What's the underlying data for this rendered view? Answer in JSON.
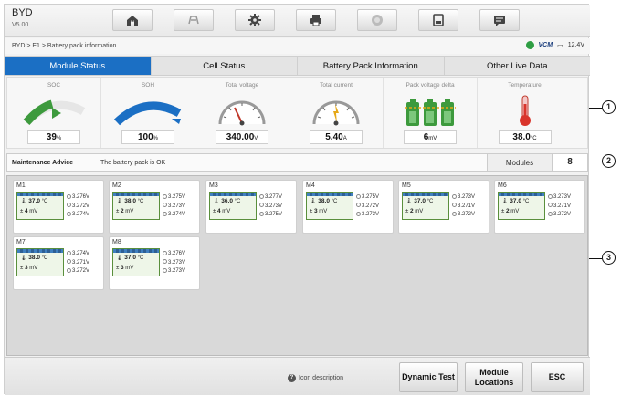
{
  "app": {
    "brand": "BYD",
    "version": "V5.00"
  },
  "toolbar": {
    "icons": [
      "home-icon",
      "vehicle-icon",
      "settings-icon",
      "print-icon",
      "help-icon",
      "save-icon",
      "message-icon"
    ]
  },
  "breadcrumb": "BYD > E1 > Battery pack information",
  "status": {
    "vcm_label": "VCM",
    "battery": "12.4V",
    "colors": {
      "connected": "#2f9e44",
      "vcm": "#1a3d7c"
    }
  },
  "tabs": [
    {
      "label": "Module Status",
      "active": true
    },
    {
      "label": "Cell Status",
      "active": false
    },
    {
      "label": "Battery Pack Information",
      "active": false
    },
    {
      "label": "Other Live Data",
      "active": false
    }
  ],
  "gauges": [
    {
      "label": "SOC",
      "value": "39",
      "unit": "%"
    },
    {
      "label": "SOH",
      "value": "100",
      "unit": "%"
    },
    {
      "label": "Total voltage",
      "value": "340.00",
      "unit": "V"
    },
    {
      "label": "Total current",
      "value": "5.40",
      "unit": "A"
    },
    {
      "label": "Pack voltage delta",
      "value": "6",
      "unit": "mV"
    },
    {
      "label": "Temperature",
      "value": "38.0",
      "unit": "°C"
    }
  ],
  "maintenance": {
    "label": "Maintenance Advice",
    "text": "The battery pack is OK",
    "modules_label": "Modules",
    "modules_count": "8"
  },
  "modules": [
    {
      "name": "M1",
      "temp": "37.0",
      "temp_unit": "°C",
      "delta": "4",
      "delta_unit": "mV",
      "volts": [
        "3.276V",
        "3.272V",
        "3.274V"
      ]
    },
    {
      "name": "M2",
      "temp": "38.0",
      "temp_unit": "°C",
      "delta": "2",
      "delta_unit": "mV",
      "volts": [
        "3.275V",
        "3.273V",
        "3.274V"
      ]
    },
    {
      "name": "M3",
      "temp": "36.0",
      "temp_unit": "°C",
      "delta": "4",
      "delta_unit": "mV",
      "volts": [
        "3.277V",
        "3.273V",
        "3.275V"
      ]
    },
    {
      "name": "M4",
      "temp": "38.0",
      "temp_unit": "°C",
      "delta": "3",
      "delta_unit": "mV",
      "volts": [
        "3.275V",
        "3.272V",
        "3.273V"
      ]
    },
    {
      "name": "M5",
      "temp": "37.0",
      "temp_unit": "°C",
      "delta": "2",
      "delta_unit": "mV",
      "volts": [
        "3.273V",
        "3.271V",
        "3.272V"
      ]
    },
    {
      "name": "M6",
      "temp": "37.0",
      "temp_unit": "°C",
      "delta": "2",
      "delta_unit": "mV",
      "volts": [
        "3.273V",
        "3.271V",
        "3.272V"
      ]
    },
    {
      "name": "M7",
      "temp": "38.0",
      "temp_unit": "°C",
      "delta": "3",
      "delta_unit": "mV",
      "volts": [
        "3.274V",
        "3.271V",
        "3.272V"
      ]
    },
    {
      "name": "M8",
      "temp": "37.0",
      "temp_unit": "°C",
      "delta": "3",
      "delta_unit": "mV",
      "volts": [
        "3.276V",
        "3.273V",
        "3.273V"
      ]
    }
  ],
  "bottom": {
    "icon_desc": "Icon description",
    "dynamic_test": "Dynamic Test",
    "module_locations": "Module Locations",
    "esc": "ESC"
  },
  "callouts": [
    "1",
    "2",
    "3"
  ]
}
